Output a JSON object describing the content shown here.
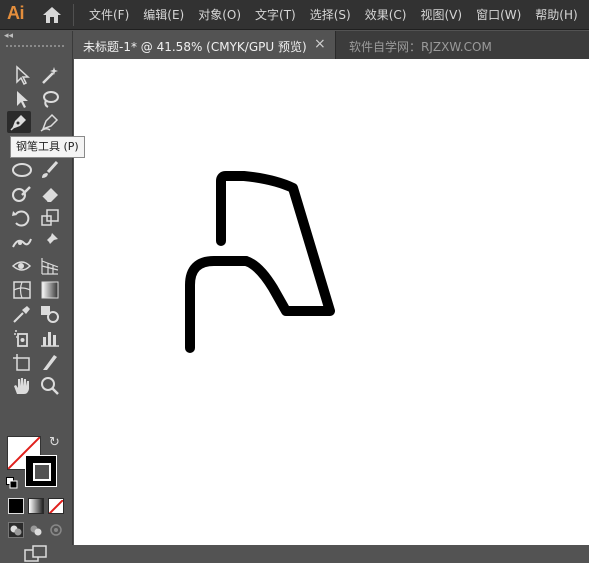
{
  "app": {
    "logo": "Ai"
  },
  "menu": {
    "items": [
      "文件(F)",
      "编辑(E)",
      "对象(O)",
      "文字(T)",
      "选择(S)",
      "效果(C)",
      "视图(V)",
      "窗口(W)",
      "帮助(H)"
    ]
  },
  "tabs": [
    {
      "label": "未标题-1* @ 41.58% (CMYK/GPU 预览)",
      "close": "×"
    },
    {
      "label": "软件自学网：RJZXW.COM"
    }
  ],
  "toolbar": {
    "collapse": "◂◂",
    "swap": "↻"
  },
  "tooltip": {
    "text": "钢笔工具 (P)"
  },
  "colors": {
    "stroke": "#000000",
    "fill": "none",
    "canvas": "#ffffff",
    "logo": "#e48e3c"
  }
}
